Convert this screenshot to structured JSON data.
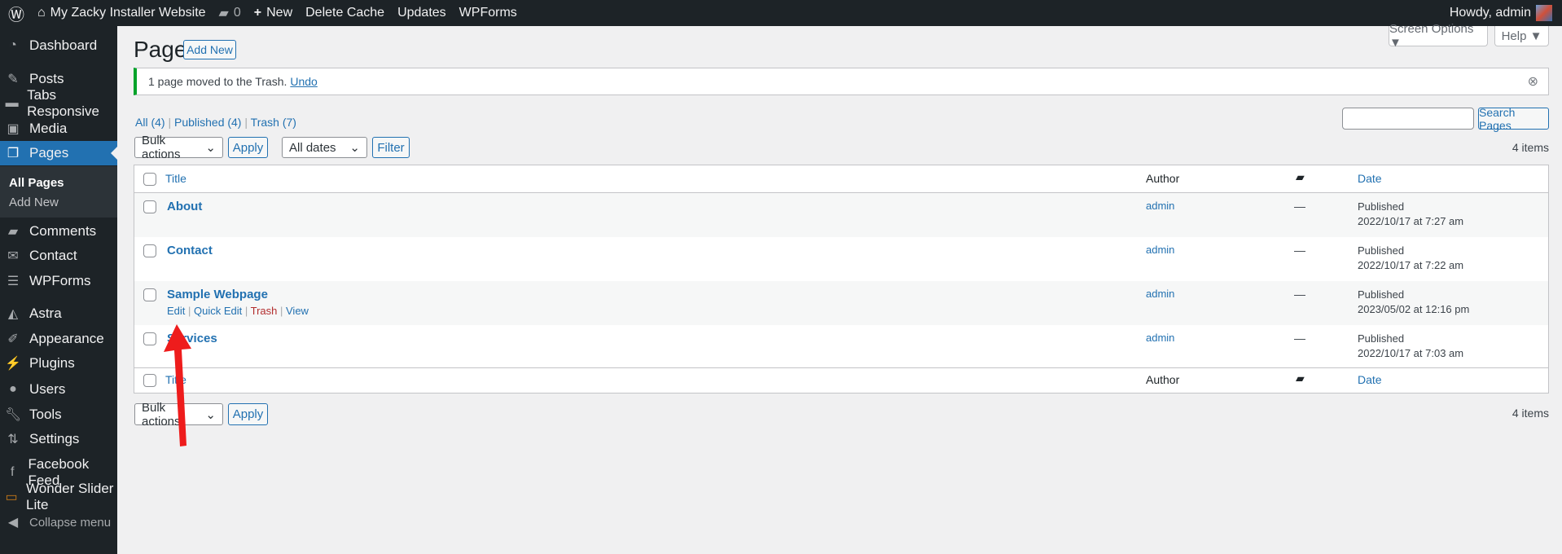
{
  "admin_bar": {
    "site_name": "My Zacky Installer Website",
    "comments_count": "0",
    "new_label": "New",
    "delete_cache": "Delete Cache",
    "updates": "Updates",
    "wpforms": "WPForms",
    "howdy": "Howdy, admin"
  },
  "sidebar": {
    "items": [
      {
        "label": "Dashboard",
        "icon": "dashboard-icon"
      },
      {
        "label": "Posts",
        "icon": "pin-icon"
      },
      {
        "label": "Tabs Responsive",
        "icon": "folder-icon"
      },
      {
        "label": "Media",
        "icon": "media-icon"
      },
      {
        "label": "Pages",
        "icon": "pages-icon"
      },
      {
        "label": "Comments",
        "icon": "comment-icon"
      },
      {
        "label": "Contact",
        "icon": "mail-icon"
      },
      {
        "label": "WPForms",
        "icon": "form-icon"
      },
      {
        "label": "Astra",
        "icon": "astra-icon"
      },
      {
        "label": "Appearance",
        "icon": "brush-icon"
      },
      {
        "label": "Plugins",
        "icon": "plugin-icon"
      },
      {
        "label": "Users",
        "icon": "user-icon"
      },
      {
        "label": "Tools",
        "icon": "wrench-icon"
      },
      {
        "label": "Settings",
        "icon": "settings-icon"
      },
      {
        "label": "Facebook Feed",
        "icon": "facebook-icon"
      },
      {
        "label": "Wonder Slider Lite",
        "icon": "slider-icon"
      }
    ],
    "submenu": [
      "All Pages",
      "Add New"
    ],
    "collapse": "Collapse menu"
  },
  "header": {
    "title": "Pages",
    "add_new": "Add New",
    "screen_options": "Screen Options ▼",
    "help": "Help ▼"
  },
  "notice": {
    "text": "1 page moved to the Trash.",
    "undo": "Undo"
  },
  "filters": {
    "all": "All (4)",
    "published": "Published (4)",
    "trash": "Trash (7)",
    "bulk_actions": "Bulk actions",
    "apply": "Apply",
    "all_dates": "All dates",
    "filter": "Filter",
    "search_value": "",
    "search_button": "Search Pages",
    "count": "4 items"
  },
  "table": {
    "columns": {
      "title": "Title",
      "author": "Author",
      "date": "Date"
    },
    "rows": [
      {
        "title": "About",
        "author": "admin",
        "comments": "—",
        "status": "Published",
        "date": "2022/10/17 at 7:27 am"
      },
      {
        "title": "Contact",
        "author": "admin",
        "comments": "—",
        "status": "Published",
        "date": "2022/10/17 at 7:22 am"
      },
      {
        "title": "Sample Webpage",
        "author": "admin",
        "comments": "—",
        "status": "Published",
        "date": "2023/05/02 at 12:16 pm",
        "actions": {
          "edit": "Edit",
          "quick_edit": "Quick Edit",
          "trash": "Trash",
          "view": "View"
        }
      },
      {
        "title": "Services",
        "author": "admin",
        "comments": "—",
        "status": "Published",
        "date": "2022/10/17 at 7:03 am"
      }
    ]
  },
  "colors": {
    "accent": "#2271b1",
    "sidebar": "#1d2327",
    "notice_success": "#00a32a",
    "trash": "#b32d2e",
    "annotation_arrow": "#ee1c1c"
  }
}
